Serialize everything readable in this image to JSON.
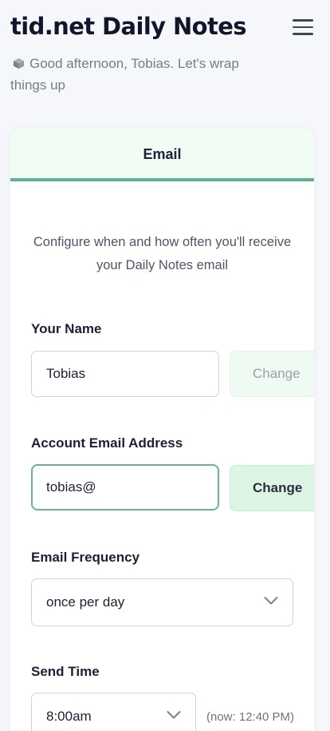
{
  "header": {
    "title": "tid.net Daily Notes",
    "greeting": "Good afternoon, Tobias. Let's wrap things up"
  },
  "tabs": [
    {
      "label": "Email",
      "active": true
    }
  ],
  "email_settings": {
    "description": "Configure when and how often you'll receive your Daily Notes email",
    "name_label": "Your Name",
    "name_value": "Tobias",
    "name_change": "Change",
    "email_label": "Account Email Address",
    "email_value": "tobias@",
    "email_change": "Change",
    "frequency_label": "Email Frequency",
    "frequency_value": "once per day",
    "send_time_label": "Send Time",
    "send_time_value": "8:00am",
    "now_note": "(now: 12:40 PM)"
  },
  "colors": {
    "accent": "#5cb48e",
    "tab_bg": "#f0fcf4",
    "button_active_bg": "#dcf5e4",
    "button_disabled_bg": "#effaf2"
  },
  "icons": {
    "menu": "hamburger-icon",
    "greeting": "cube-icon",
    "dropdown": "chevron-down-icon"
  }
}
